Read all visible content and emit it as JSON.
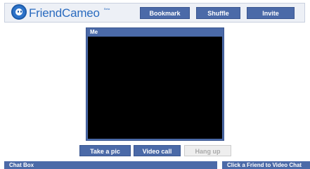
{
  "header": {
    "logo_text": "FriendCameo",
    "logo_badge": "Beta",
    "buttons": {
      "bookmark": "Bookmark",
      "shuffle": "Shuffle",
      "invite": "Invite"
    }
  },
  "video": {
    "title": "Me"
  },
  "actions": {
    "take_pic": "Take a pic",
    "video_call": "Video call",
    "hang_up": "Hang up"
  },
  "footer": {
    "chat_box": "Chat Box",
    "friend_prompt": "Click a Friend to Video Chat"
  },
  "colors": {
    "accent": "#4b6aa8",
    "header_bg": "#edf0f6",
    "logo": "#2a6bbf",
    "disabled": "#eeeeee"
  }
}
